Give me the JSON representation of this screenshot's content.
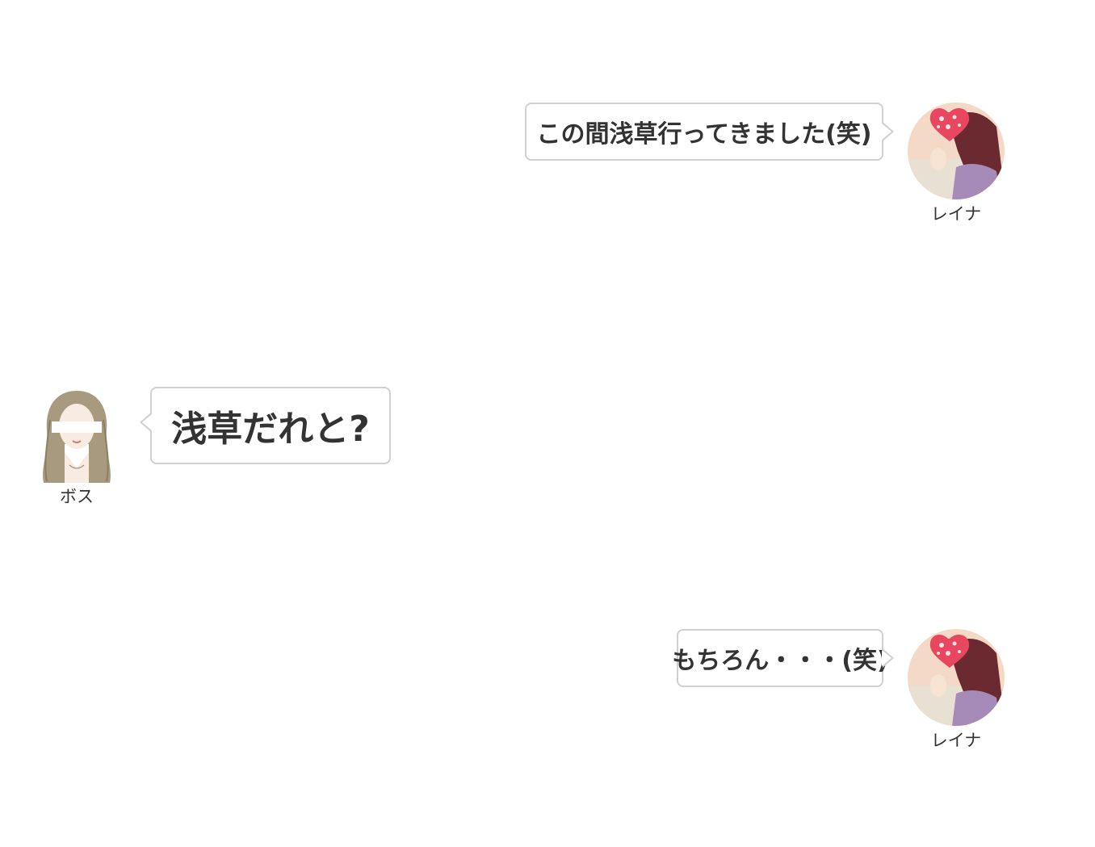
{
  "messages": [
    {
      "side": "right",
      "speaker": "レイナ",
      "text": "この間浅草行ってきました(笑)"
    },
    {
      "side": "left",
      "speaker": "ボス",
      "text": "浅草だれと?"
    },
    {
      "side": "right",
      "speaker": "レイナ",
      "text": "もちろん・・・(笑)"
    }
  ],
  "colors": {
    "bubble_border": "#d0d0d0",
    "text": "#333333",
    "heart": "#e8475f",
    "avatar_bg": "#f3d9c6",
    "hair": "#6b2a2f",
    "sweater": "#a68ab8"
  }
}
